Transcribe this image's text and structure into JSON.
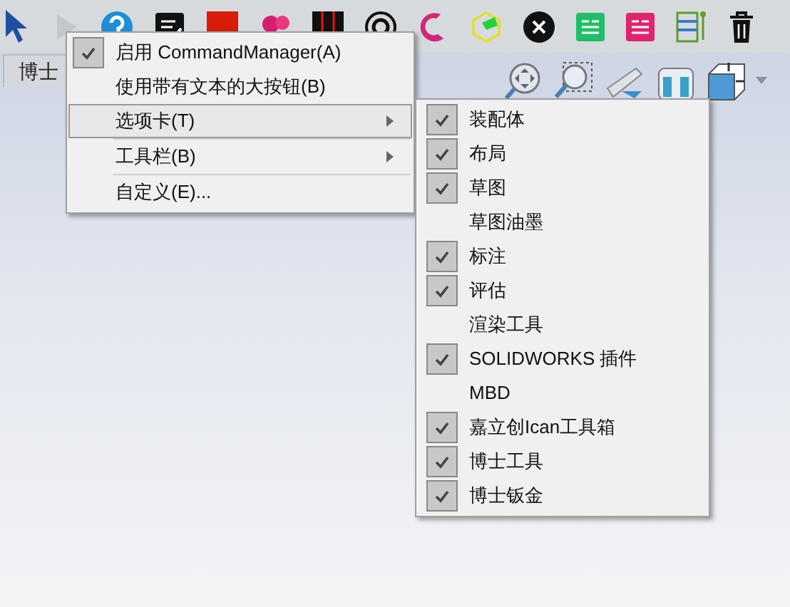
{
  "tab_strip": {
    "tab_label": "博士"
  },
  "context_menu": {
    "items": [
      {
        "label": "启用 CommandManager(A)",
        "checked": true,
        "selected": false,
        "submenu": false
      },
      {
        "label": "使用带有文本的大按钮(B)",
        "checked": false,
        "selected": false,
        "submenu": false
      },
      {
        "label": "选项卡(T)",
        "checked": false,
        "selected": true,
        "submenu": true,
        "separator_after": true
      },
      {
        "label": "工具栏(B)",
        "checked": false,
        "selected": false,
        "submenu": true,
        "separator_after": true
      },
      {
        "label": "自定义(E)...",
        "checked": false,
        "selected": false,
        "submenu": false
      }
    ]
  },
  "tabs_submenu": {
    "items": [
      {
        "label": "装配体",
        "checked": true
      },
      {
        "label": "布局",
        "checked": true
      },
      {
        "label": "草图",
        "checked": true
      },
      {
        "label": "草图油墨",
        "checked": false
      },
      {
        "label": "标注",
        "checked": true
      },
      {
        "label": "评估",
        "checked": true
      },
      {
        "label": "渲染工具",
        "checked": false
      },
      {
        "label": "SOLIDWORKS 插件",
        "checked": true
      },
      {
        "label": "MBD",
        "checked": false
      },
      {
        "label": "嘉立创Ican工具箱",
        "checked": true
      },
      {
        "label": "博士工具",
        "checked": true
      },
      {
        "label": "博士钣金",
        "checked": true
      }
    ]
  }
}
